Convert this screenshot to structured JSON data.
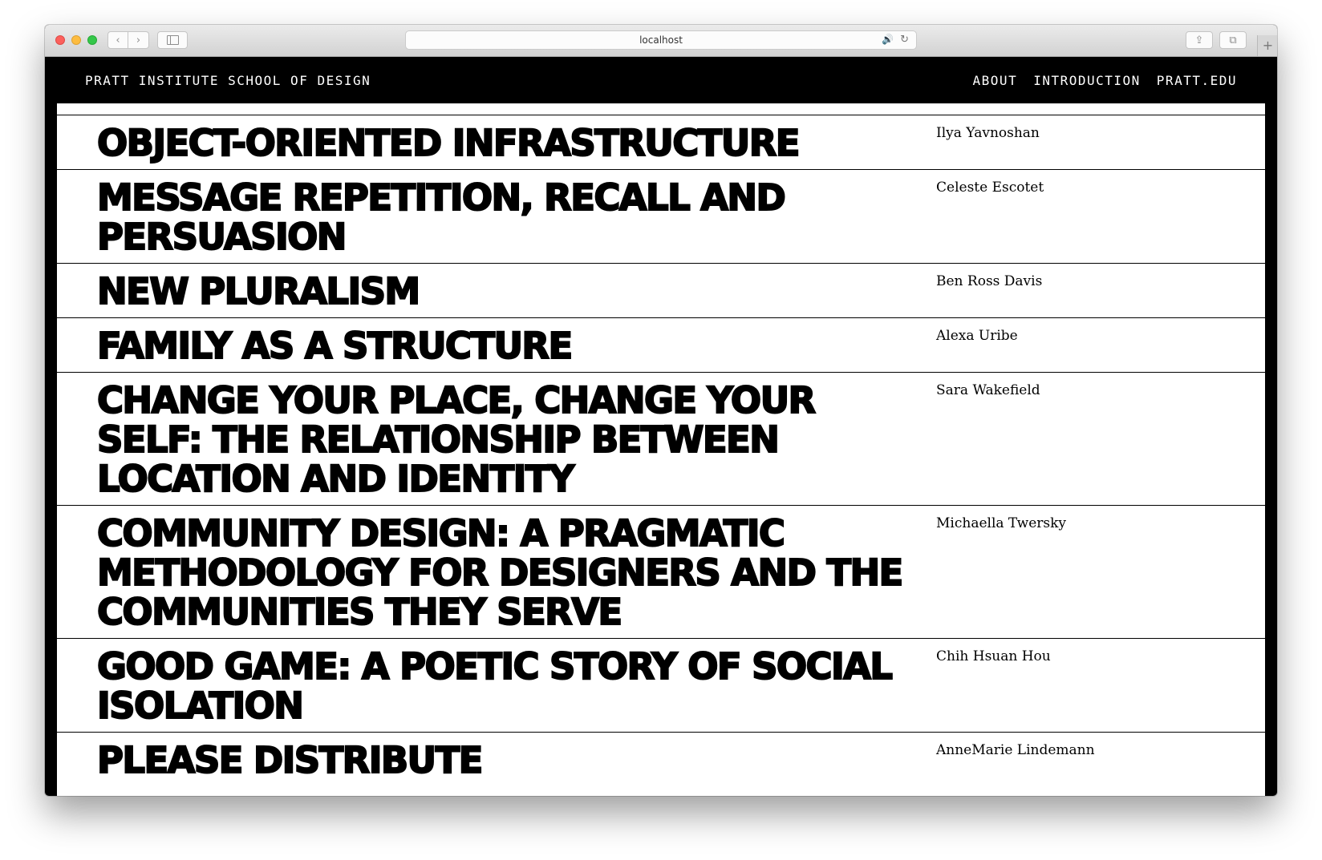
{
  "browser": {
    "url": "localhost",
    "nav_back": "‹",
    "nav_forward": "›",
    "speaker": "🔊",
    "reload": "↻",
    "share": "⇪",
    "tabs": "⧉",
    "new_tab": "+"
  },
  "header": {
    "brand": "PRATT INSTITUTE SCHOOL OF DESIGN",
    "nav": [
      "ABOUT",
      "INTRODUCTION",
      "PRATT.EDU"
    ]
  },
  "theses": [
    {
      "title": "OBJECT-ORIENTED INFRASTRUCTURE",
      "author": "Ilya Yavnoshan"
    },
    {
      "title": "MESSAGE REPETITION, RECALL AND PERSUASION",
      "author": "Celeste Escotet"
    },
    {
      "title": "NEW PLURALISM",
      "author": "Ben Ross Davis"
    },
    {
      "title": "FAMILY AS A STRUCTURE",
      "author": "Alexa Uribe"
    },
    {
      "title": "CHANGE YOUR PLACE, CHANGE YOUR SELF: THE RELATIONSHIP BETWEEN LOCATION AND IDENTITY",
      "author": "Sara Wakefield"
    },
    {
      "title": "COMMUNITY DESIGN: A PRAGMATIC METHODOLOGY FOR DESIGNERS AND THE COMMUNITIES THEY SERVE",
      "author": "Michaella Twersky"
    },
    {
      "title": "GOOD GAME: A POETIC STORY OF SOCIAL ISOLATION",
      "author": "Chih Hsuan Hou"
    },
    {
      "title": "PLEASE DISTRIBUTE",
      "author": "AnneMarie Lindemann"
    }
  ]
}
